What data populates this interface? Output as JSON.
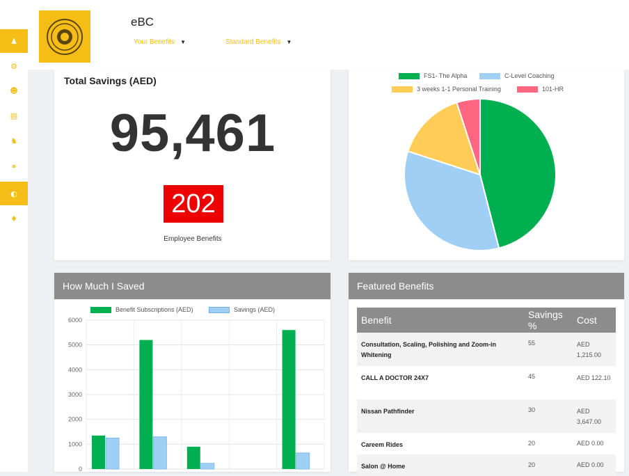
{
  "app": {
    "brand": "eBC"
  },
  "nav": {
    "your_benefits": "Your Benefits",
    "standard_benefits": "Standard Benefits"
  },
  "sidebar": {
    "icons": [
      "user-icon",
      "share-icon",
      "users-icon",
      "list-icon",
      "user-tie-icon",
      "headset-icon",
      "dashboard-icon",
      "bell-icon"
    ],
    "active_index": 6
  },
  "savings": {
    "title": "Total Savings (AED)",
    "total": "95,461",
    "badge_value": "202",
    "badge_label": "Employee Benefits"
  },
  "colors": {
    "accent": "#f6bd16",
    "badge": "#ee0000",
    "green": "#00b050",
    "blue": "#9fcff5",
    "yellow": "#ffcc55",
    "pink": "#ff6680"
  },
  "chart_data": [
    {
      "type": "pie",
      "legend": [
        "FS1- The Alpha",
        "C-Level Coaching",
        "3 weeks 1-1 Personal Training",
        "101-HR"
      ],
      "values": [
        46,
        34,
        15,
        5
      ],
      "colors": [
        "#00b050",
        "#9fcff5",
        "#ffcc55",
        "#ff6680"
      ],
      "legend_position": "top"
    },
    {
      "type": "bar",
      "title": "How Much I Saved",
      "series": [
        {
          "name": "Benefit Subscriptions (AED)",
          "values": [
            1350,
            5200,
            900,
            0,
            5600
          ],
          "color": "#00b050"
        },
        {
          "name": "Savings (AED)",
          "values": [
            1250,
            1300,
            230,
            0,
            650
          ],
          "color": "#9fcff5"
        }
      ],
      "yticks": [
        "0",
        "1000",
        "2000",
        "3000",
        "4000",
        "5000",
        "6000"
      ],
      "ylim": [
        0,
        6000
      ],
      "grid": true
    }
  ],
  "featured": {
    "title": "Featured Benefits",
    "columns": [
      "Benefit",
      "Savings %",
      "Cost"
    ],
    "rows": [
      {
        "name": "Consultation, Scaling, Polishing and Zoom-in Whitening",
        "savings": "55",
        "cost": "AED 1,215.00"
      },
      {
        "name": "CALL A DOCTOR 24X7",
        "savings": "45",
        "cost": "AED 122.10"
      },
      {
        "name": "Nissan Pathfinder",
        "savings": "30",
        "cost": "AED 3,647.00"
      },
      {
        "name": "Careem Rides",
        "savings": "20",
        "cost": "AED 0.00"
      },
      {
        "name": "Salon @ Home",
        "savings": "20",
        "cost": "AED 0.00"
      }
    ]
  }
}
